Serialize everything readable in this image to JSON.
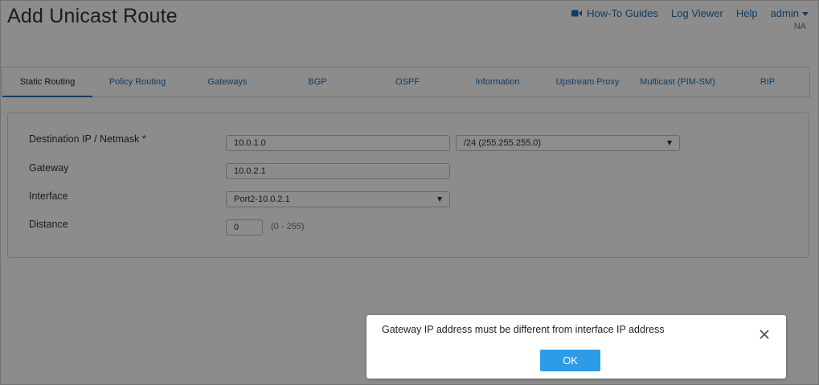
{
  "header": {
    "title": "Add Unicast Route",
    "nav": {
      "how_to": "How-To Guides",
      "log_viewer": "Log Viewer",
      "help": "Help",
      "user": "admin",
      "user_sub": "NA"
    }
  },
  "tabs": [
    {
      "label": "Static Routing",
      "active": true
    },
    {
      "label": "Policy Routing"
    },
    {
      "label": "Gateways"
    },
    {
      "label": "BGP"
    },
    {
      "label": "OSPF"
    },
    {
      "label": "Information"
    },
    {
      "label": "Upstream Proxy"
    },
    {
      "label": "Multicast (PIM-SM)"
    },
    {
      "label": "RIP"
    }
  ],
  "form": {
    "dest_label": "Destination IP / Netmask *",
    "dest_ip": "10.0.1.0",
    "netmask": "/24 (255.255.255.0)",
    "gateway_label": "Gateway",
    "gateway": "10.0.2.1",
    "interface_label": "Interface",
    "interface": "Port2-10.0.2.1",
    "distance_label": "Distance",
    "distance": "0",
    "distance_hint": "(0 - 255)"
  },
  "dialog": {
    "message": "Gateway IP address must be different from interface IP address",
    "ok_label": "OK"
  },
  "colors": {
    "link": "#1f6fb2",
    "ok_button": "#2d9be6",
    "overlay": "rgba(0,0,0,0.45)"
  },
  "icons": {
    "how_to": "video-camera-icon",
    "user_menu": "caret-down-icon",
    "select_arrow": "triangle-down-icon",
    "dialog_close": "close-icon"
  }
}
